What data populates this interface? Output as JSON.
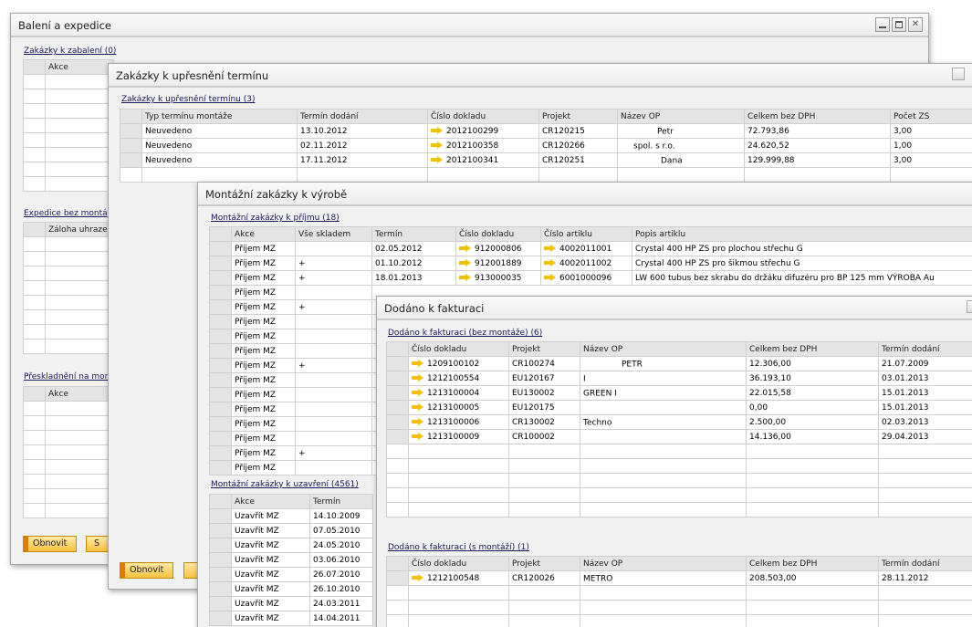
{
  "w1": {
    "title": "Balení a expedice",
    "s1": "Zakázky k zabalení (0)",
    "s1_col": "Akce",
    "s2": "Expedice bez montá",
    "s2_col": "Záloha uhrazen",
    "s3": "Přeskladnění na mor",
    "s3_col": "Akce",
    "btn_refresh": "Obnovit",
    "btn2": "S"
  },
  "w2": {
    "title": "Zakázky k upřesnění termínu",
    "section": "Zakázky k upřesnění termínu (3)",
    "cols": [
      "Typ termínu montáže",
      "Termín dodání",
      "Číslo dokladu",
      "Projekt",
      "Název OP",
      "Celkem bez DPH",
      "Počet ZS"
    ],
    "rows": [
      [
        "Neuvedeno",
        "13.10.2012",
        "2012100299",
        "CR120215",
        "Petr",
        "72.793,86",
        "3,00"
      ],
      [
        "Neuvedeno",
        "02.11.2012",
        "2012100358",
        "CR120266",
        "spol. s r.o.",
        "24.620,52",
        "1,00"
      ],
      [
        "Neuvedeno",
        "17.11.2012",
        "2012100341",
        "CR120251",
        "Dana",
        "129.999,88",
        "3,00"
      ]
    ],
    "btn_refresh": "Obnovit"
  },
  "w3": {
    "title": "Montážní zakázky k výrobě",
    "s1": "Montážní zakázky k příjmu (18)",
    "s1_cols": [
      "Akce",
      "Vše skladem",
      "Termín",
      "Číslo dokladu",
      "Číslo artiklu",
      "Popis artiklu"
    ],
    "s1_rows": [
      [
        "Příjem MZ",
        "",
        "02.05.2012",
        "912000806",
        "4002011001",
        "Crystal 400 HP ZS pro plochou střechu G"
      ],
      [
        "Příjem MZ",
        "+",
        "01.10.2012",
        "912001889",
        "4002011002",
        "Crystal 400 HP ZS pro šikmou střechu G"
      ],
      [
        "Příjem MZ",
        "+",
        "18.01.2013",
        "913000035",
        "6001000096",
        "LW 600 tubus bez skrabu do držáku difuzéru pro BP 125 mm VÝROBA Au"
      ],
      [
        "Příjem MZ",
        "",
        "",
        "",
        "",
        ""
      ],
      [
        "Příjem MZ",
        "+",
        "",
        "",
        "",
        ""
      ],
      [
        "Příjem MZ",
        "",
        "",
        "",
        "",
        ""
      ],
      [
        "Příjem MZ",
        "",
        "",
        "",
        "",
        ""
      ],
      [
        "Příjem MZ",
        "",
        "",
        "",
        "",
        ""
      ],
      [
        "Příjem MZ",
        "+",
        "",
        "",
        "",
        ""
      ],
      [
        "Příjem MZ",
        "",
        "",
        "",
        "",
        ""
      ],
      [
        "Příjem MZ",
        "",
        "",
        "",
        "",
        ""
      ],
      [
        "Příjem MZ",
        "",
        "",
        "",
        "",
        ""
      ],
      [
        "Příjem MZ",
        "",
        "",
        "",
        "",
        ""
      ],
      [
        "Příjem MZ",
        "",
        "",
        "",
        "",
        ""
      ],
      [
        "Příjem MZ",
        "+",
        "",
        "",
        "",
        ""
      ],
      [
        "Příjem MZ",
        "",
        "",
        "",
        "",
        ""
      ]
    ],
    "s2": "Montážní zakázky k uzavření (4561)",
    "s2_cols": [
      "Akce",
      "Termín"
    ],
    "s2_rows": [
      [
        "Uzavřít MZ",
        "14.10.2009"
      ],
      [
        "Uzavřít MZ",
        "07.05.2010"
      ],
      [
        "Uzavřít MZ",
        "24.05.2010"
      ],
      [
        "Uzavřít MZ",
        "03.06.2010"
      ],
      [
        "Uzavřít MZ",
        "26.07.2010"
      ],
      [
        "Uzavřít MZ",
        "26.10.2010"
      ],
      [
        "Uzavřít MZ",
        "24.03.2011"
      ],
      [
        "Uzavřít MZ",
        "14.04.2011"
      ]
    ]
  },
  "w4": {
    "title": "Dodáno k fakturaci",
    "s1": "Dodáno k fakturaci (bez montáže) (6)",
    "cols": [
      "Číslo dokladu",
      "Projekt",
      "Název OP",
      "Celkem bez DPH",
      "Termín dodání"
    ],
    "s1_rows": [
      [
        "1209100102",
        "CR100274",
        "PETR",
        "12.306,00",
        "21.07.2009"
      ],
      [
        "1212100554",
        "EU120167",
        "I",
        "36.193,10",
        "03.01.2013"
      ],
      [
        "1213100004",
        "EU130002",
        "GREEN I",
        "22.015,58",
        "15.01.2013"
      ],
      [
        "1213100005",
        "EU120175",
        "",
        "0,00",
        "15.01.2013"
      ],
      [
        "1213100006",
        "CR130002",
        "Techno",
        "2.500,00",
        "02.03.2013"
      ],
      [
        "1213100009",
        "CR100002",
        "",
        "14.136,00",
        "29.04.2013"
      ]
    ],
    "s2": "Dodáno k fakturaci (s montáží) (1)",
    "s2_rows": [
      [
        "1212100548",
        "CR120026",
        "METRO",
        "208.503,00",
        "28.11.2012"
      ]
    ]
  }
}
